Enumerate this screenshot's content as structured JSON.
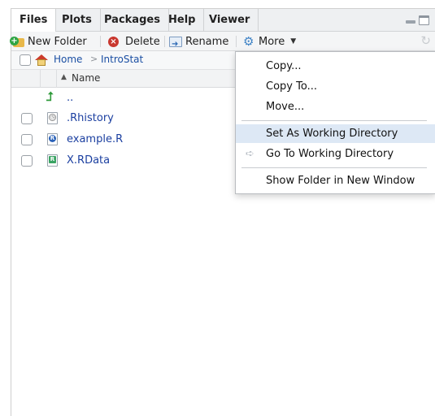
{
  "tabs": [
    {
      "label": "Files",
      "active": true
    },
    {
      "label": "Plots",
      "active": false
    },
    {
      "label": "Packages",
      "active": false
    },
    {
      "label": "Help",
      "active": false
    },
    {
      "label": "Viewer",
      "active": false
    }
  ],
  "toolbar": {
    "new_folder": "New Folder",
    "delete": "Delete",
    "rename": "Rename",
    "more": "More"
  },
  "breadcrumb": {
    "home": "Home",
    "separator": ">",
    "folder": "IntroStat"
  },
  "columns": {
    "name": "Name",
    "sort_indicator": "▲"
  },
  "files": [
    {
      "name": "..",
      "type": "parent"
    },
    {
      "name": ".Rhistory",
      "type": "history"
    },
    {
      "name": "example.R",
      "type": "r-script"
    },
    {
      "name": "X.RData",
      "type": "rdata"
    }
  ],
  "menu": {
    "items": [
      {
        "label": "Copy...",
        "highlighted": false
      },
      {
        "label": "Copy To...",
        "highlighted": false
      },
      {
        "label": "Move...",
        "highlighted": false
      },
      {
        "label": "Set As Working Directory",
        "highlighted": true
      },
      {
        "label": "Go To Working Directory",
        "highlighted": false
      },
      {
        "label": "Show Folder in New Window",
        "highlighted": false
      }
    ]
  },
  "colors": {
    "link": "#1b3fa0",
    "highlight": "#dde8f5",
    "tabbar": "#eef0f2"
  }
}
